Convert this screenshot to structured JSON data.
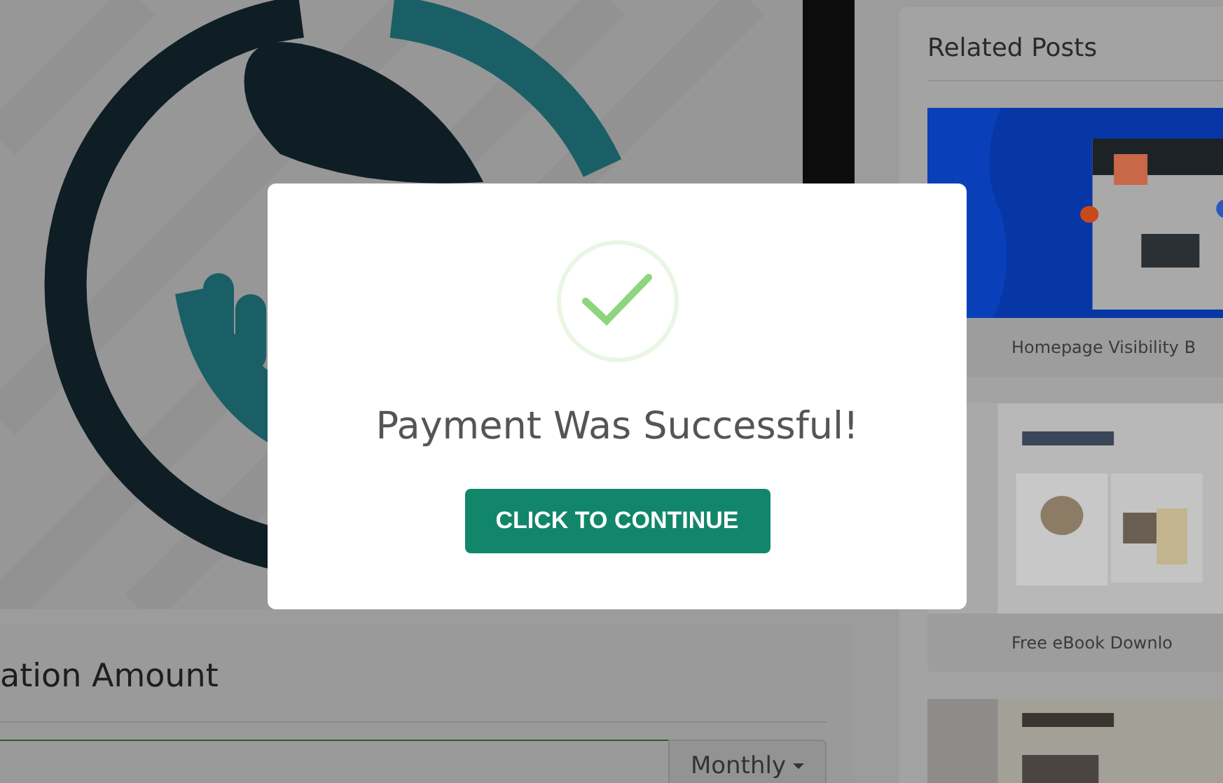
{
  "donation": {
    "title": "ation Amount",
    "frequency": "Monthly"
  },
  "sidebar": {
    "title": "Related Posts",
    "posts": [
      {
        "kind": "seo",
        "caption": "Homepage Visibility B"
      },
      {
        "kind": "ebook",
        "caption": "Free eBook Downlo"
      },
      {
        "kind": "ebook2"
      }
    ]
  },
  "modal": {
    "message": "Payment Was Successful!",
    "button": "CLICK TO CONTINUE"
  }
}
